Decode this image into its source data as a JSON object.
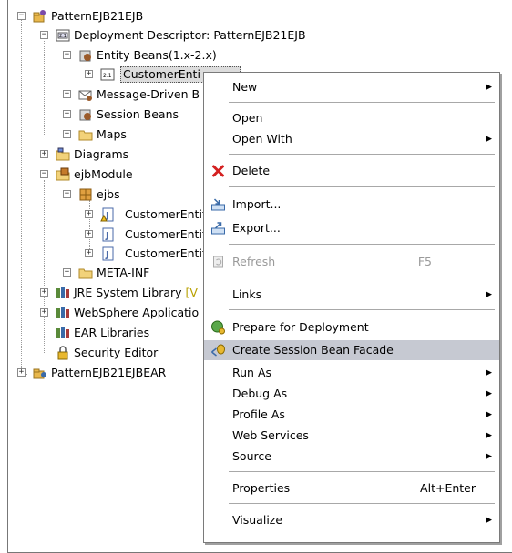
{
  "tree": {
    "project_ejb": "PatternEJB21EJB",
    "deployment_descriptor": "Deployment Descriptor: PatternEJB21EJB",
    "entity_beans": "Entity Beans(1.x-2.x)",
    "customer_entity_selected": "CustomerEnti",
    "mdb": "Message-Driven B",
    "session_beans": "Session Beans",
    "maps": "Maps",
    "diagrams": "Diagrams",
    "ejb_module": "ejbModule",
    "ejbs": "ejbs",
    "ejbs_children": [
      "CustomerEntit",
      "CustomerEntit",
      "CustomerEntit"
    ],
    "meta_inf": "META-INF",
    "jre": "JRE System Library",
    "jre_suffix": "[V",
    "websphere": "WebSphere Applicatio",
    "ear_libs": "EAR Libraries",
    "security": "Security Editor",
    "project_ear": "PatternEJB21EJBEAR"
  },
  "menu": {
    "new": "New",
    "open": "Open",
    "open_with": "Open With",
    "delete": "Delete",
    "import": "Import...",
    "export": "Export...",
    "refresh": "Refresh",
    "refresh_key": "F5",
    "links": "Links",
    "prepare": "Prepare for Deployment",
    "create_facade": "Create Session Bean Facade",
    "run_as": "Run As",
    "debug_as": "Debug As",
    "profile_as": "Profile As",
    "web_services": "Web Services",
    "source": "Source",
    "properties": "Properties",
    "properties_key": "Alt+Enter",
    "visualize": "Visualize"
  },
  "colors": {
    "highlight": "#c6c9d2",
    "delete_red": "#d42020",
    "folder": "#e8b84a"
  }
}
